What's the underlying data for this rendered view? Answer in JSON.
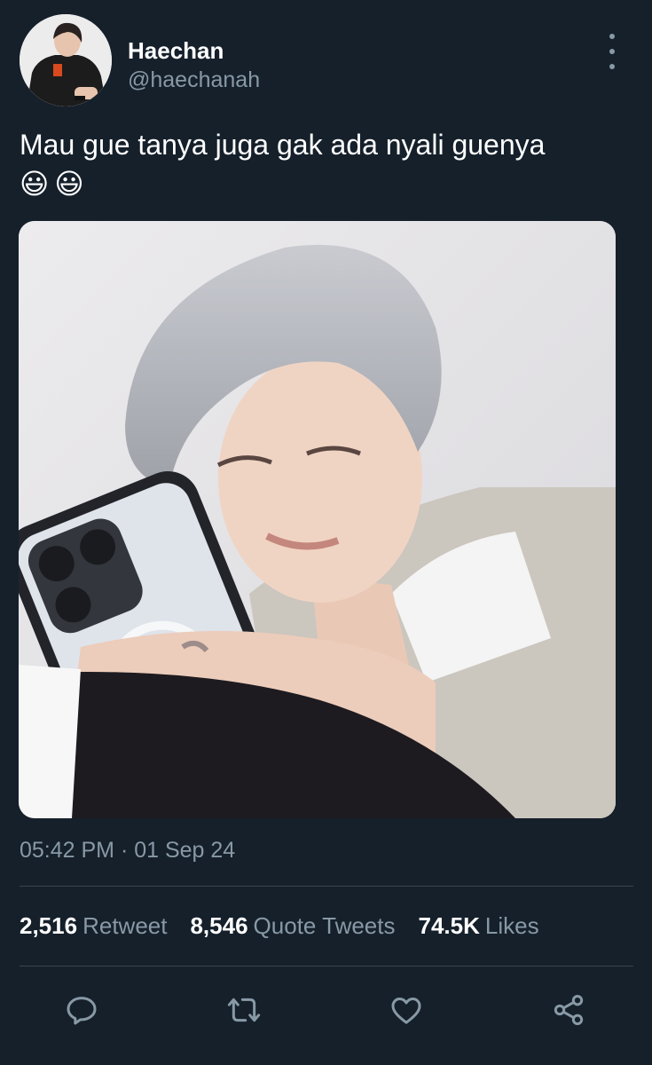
{
  "tweet": {
    "author": {
      "display_name": "Haechan",
      "handle": "@haechanah"
    },
    "text": "Mau gue tanya juga gak ada nyali guenya",
    "emojis": [
      "😃",
      "😃"
    ],
    "time": "05:42 PM · 01 Sep 24",
    "stats": [
      {
        "count": "2,516",
        "label": "Retweet"
      },
      {
        "count": "8,546",
        "label": "Quote Tweets"
      },
      {
        "count": "74.5K",
        "label": "Likes"
      }
    ]
  },
  "actions": {
    "reply_icon": "reply-icon",
    "retweet_icon": "retweet-icon",
    "like_icon": "heart-icon",
    "share_icon": "share-icon"
  },
  "colors": {
    "background": "#15202b",
    "secondary_text": "#8899a6",
    "divider": "#38444d",
    "primary_text": "#ffffff"
  }
}
